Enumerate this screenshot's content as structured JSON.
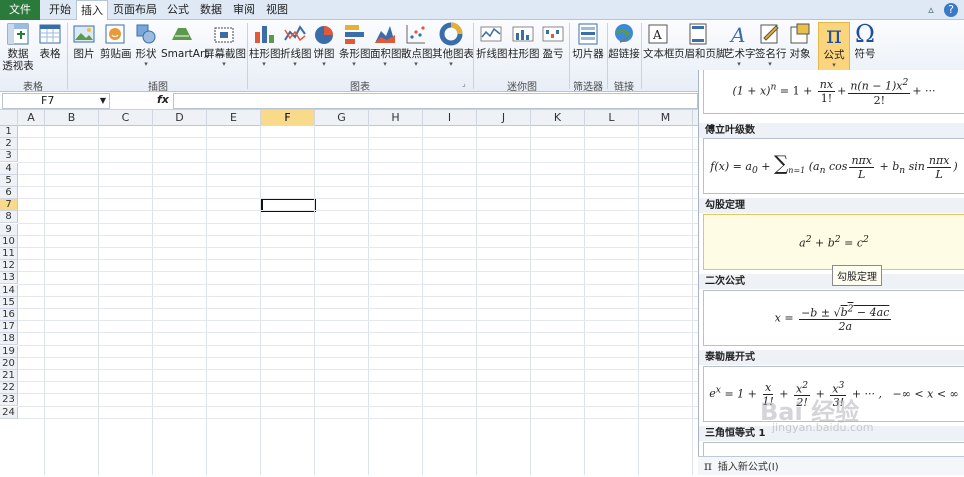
{
  "tabs": [
    "文件",
    "开始",
    "插入",
    "页面布局",
    "公式",
    "数据",
    "审阅",
    "视图"
  ],
  "ribbon": {
    "groups": [
      {
        "label": "表格",
        "items": [
          "数据",
          "透视表",
          "表格"
        ]
      },
      {
        "label": "插图",
        "items": [
          "图片",
          "剪贴画",
          "形状",
          "SmartArt",
          "屏幕截图"
        ]
      },
      {
        "label": "图表",
        "items": [
          "柱形图",
          "折线图",
          "饼图",
          "条形图",
          "面积图",
          "散点图",
          "其他图表"
        ]
      },
      {
        "label": "迷你图",
        "items": [
          "折线图",
          "柱形图",
          "盈亏"
        ]
      },
      {
        "label": "筛选器",
        "items": [
          "切片器"
        ]
      },
      {
        "label": "链接",
        "items": [
          "超链接"
        ]
      },
      {
        "label": "",
        "items": [
          "文本框",
          "页眉和页脚",
          "艺术字",
          "签名行",
          "对象",
          "公式",
          "符号"
        ]
      }
    ]
  },
  "formula_bar": {
    "name_box": "F7",
    "fx": "fx",
    "value": ""
  },
  "columns": [
    "A",
    "B",
    "C",
    "D",
    "E",
    "F",
    "G",
    "H",
    "I",
    "J",
    "K",
    "L",
    "M"
  ],
  "rows": [
    "1",
    "2",
    "3",
    "4",
    "5",
    "6",
    "7",
    "8",
    "9",
    "10",
    "11",
    "12",
    "13",
    "14",
    "15",
    "16",
    "17",
    "18",
    "19",
    "20",
    "21",
    "22",
    "23",
    "24"
  ],
  "selected": {
    "column": "F",
    "row": "7"
  },
  "panel": {
    "sections": [
      {
        "title": "",
        "formula": "binomial"
      },
      {
        "title": "傅立叶级数",
        "formula": "fourier"
      },
      {
        "title": "勾股定理",
        "formula": "pythag"
      },
      {
        "title": "二次公式",
        "formula": "quadratic"
      },
      {
        "title": "泰勒展开式",
        "formula": "taylor"
      },
      {
        "title": "三角恒等式 1",
        "formula": ""
      }
    ],
    "tooltip": "勾股定理",
    "footer": "插入新公式(I)",
    "footer_icon": "π"
  },
  "watermark": "Bai 经验",
  "watermark_url": "jingyan.baidu.com",
  "colors": {
    "file_tab": "#2a7a3b",
    "selection": "#f9d98a",
    "ribbon_border": "#b6c6da"
  }
}
